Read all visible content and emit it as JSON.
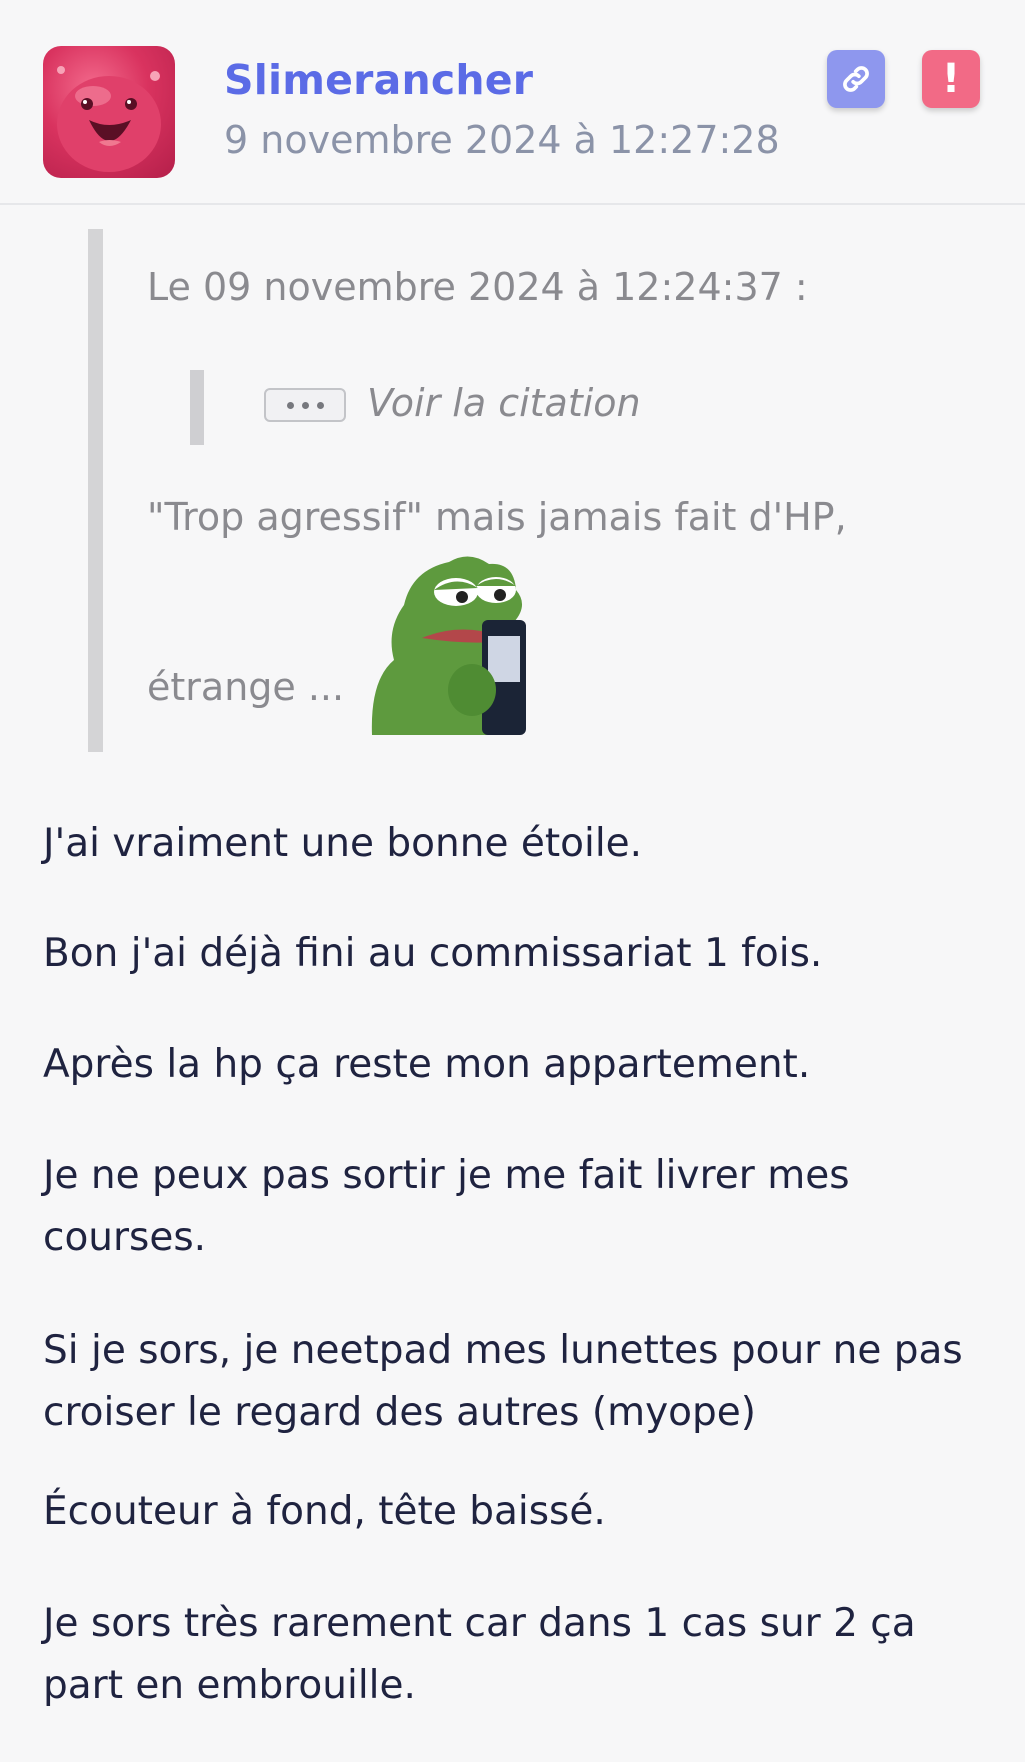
{
  "post": {
    "author": "Slimerancher",
    "timestamp": "9 novembre 2024 à 12:27:28",
    "avatar_icon": "pink-slime-avatar",
    "link_icon": "link-icon",
    "report_icon": "exclamation-icon",
    "report_label": "!"
  },
  "quote": {
    "meta": "Le 09 novembre 2024 à 12:24:37 :",
    "nested_toggle_icon": "ellipsis-icon",
    "nested_label": "Voir la citation",
    "text_line1": "\"Trop agressif\" mais jamais fait d'HP,",
    "text_line2": "étrange ...",
    "sticker": "pepe-sticker"
  },
  "body": {
    "paragraphs": [
      "J'ai vraiment une bonne étoile.",
      "Bon j'ai déjà fini au commissariat 1 fois.",
      "Après la hp ça reste mon appartement.",
      "Je ne peux pas sortir je me fait livrer mes courses.",
      "Si je sors, je neetpad mes lunettes pour ne pas croiser le regard des autres (myope)",
      "Écouteur à fond, tête baissé.",
      "Je sors très rarement car dans 1 cas sur 2 ça part en embrouille."
    ]
  },
  "colors": {
    "author": "#5b6be6",
    "link_button": "#8e97ee",
    "report_button": "#f26a86",
    "quote_bar": "#d4d4d6"
  }
}
